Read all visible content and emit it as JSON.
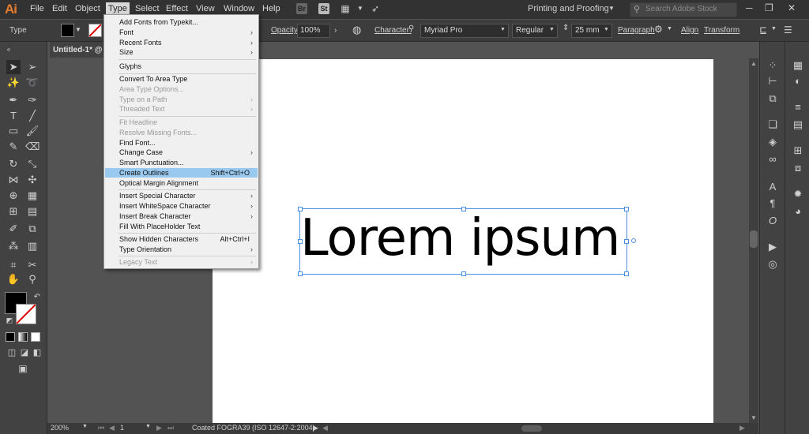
{
  "app": {
    "logo": "Ai"
  },
  "menubar": {
    "items": [
      "File",
      "Edit",
      "Object",
      "Type",
      "Select",
      "Effect",
      "View",
      "Window",
      "Help"
    ],
    "bridge_label": "Br",
    "stock_label": "St",
    "workspace": "Printing and Proofing",
    "search_placeholder": "Search Adobe Stock"
  },
  "control_bar": {
    "selection_label": "Type",
    "opacity_label": "Opacity:",
    "opacity_value": "100%",
    "character_label": "Character:",
    "font_family": "Myriad Pro",
    "font_style": "Regular",
    "font_size": "25 mm",
    "paragraph_label": "Paragraph",
    "align_label": "Align",
    "transform_label": "Transform"
  },
  "document": {
    "tab_title": "Untitled-1* @ 2",
    "text": "Lorem ipsum"
  },
  "status_bar": {
    "zoom": "200%",
    "artboard_number": "1",
    "color_profile": "Coated FOGRA39 (ISO 12647-2:2004)"
  },
  "type_menu": {
    "items": [
      {
        "label": "Add Fonts from Typekit...",
        "shortcut": "",
        "submenu": false,
        "disabled": false
      },
      {
        "label": "Font",
        "shortcut": "",
        "submenu": true,
        "disabled": false
      },
      {
        "label": "Recent Fonts",
        "shortcut": "",
        "submenu": true,
        "disabled": false
      },
      {
        "label": "Size",
        "shortcut": "",
        "submenu": true,
        "disabled": false
      },
      {
        "label": "Glyphs",
        "shortcut": "",
        "submenu": false,
        "disabled": false
      },
      {
        "label": "Convert To Area Type",
        "shortcut": "",
        "submenu": false,
        "disabled": false
      },
      {
        "label": "Area Type Options...",
        "shortcut": "",
        "submenu": false,
        "disabled": true
      },
      {
        "label": "Type on a Path",
        "shortcut": "",
        "submenu": true,
        "disabled": true
      },
      {
        "label": "Threaded Text",
        "shortcut": "",
        "submenu": true,
        "disabled": true
      },
      {
        "label": "Fit Headline",
        "shortcut": "",
        "submenu": false,
        "disabled": true
      },
      {
        "label": "Resolve Missing Fonts...",
        "shortcut": "",
        "submenu": false,
        "disabled": true
      },
      {
        "label": "Find Font...",
        "shortcut": "",
        "submenu": false,
        "disabled": false
      },
      {
        "label": "Change Case",
        "shortcut": "",
        "submenu": true,
        "disabled": false
      },
      {
        "label": "Smart Punctuation...",
        "shortcut": "",
        "submenu": false,
        "disabled": false
      },
      {
        "label": "Create Outlines",
        "shortcut": "Shift+Ctrl+O",
        "submenu": false,
        "disabled": false,
        "highlighted": true
      },
      {
        "label": "Optical Margin Alignment",
        "shortcut": "",
        "submenu": false,
        "disabled": false
      },
      {
        "label": "Insert Special Character",
        "shortcut": "",
        "submenu": true,
        "disabled": false
      },
      {
        "label": "Insert WhiteSpace Character",
        "shortcut": "",
        "submenu": true,
        "disabled": false
      },
      {
        "label": "Insert Break Character",
        "shortcut": "",
        "submenu": true,
        "disabled": false
      },
      {
        "label": "Fill With PlaceHolder Text",
        "shortcut": "",
        "submenu": false,
        "disabled": false
      },
      {
        "label": "Show Hidden Characters",
        "shortcut": "Alt+Ctrl+I",
        "submenu": false,
        "disabled": false
      },
      {
        "label": "Type Orientation",
        "shortcut": "",
        "submenu": true,
        "disabled": false
      },
      {
        "label": "Legacy Text",
        "shortcut": "",
        "submenu": true,
        "disabled": true
      }
    ]
  },
  "colors": {
    "accent": "#99c9ef",
    "selection": "#4a90e2",
    "brand": "#e27b2b"
  }
}
